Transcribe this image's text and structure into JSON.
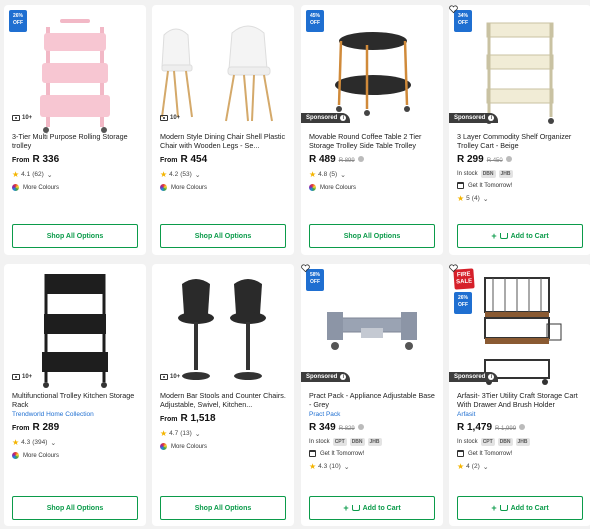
{
  "accent_color": "#0b9b4a",
  "badge_color": "#1f6fd1",
  "products": [
    {
      "discount": "26% OFF",
      "image_count": "10+",
      "title": "3-Tier Multi Purpose Rolling Storage trolley",
      "price_prefix": "From",
      "price": "R 336",
      "rating": "4.1",
      "reviews": "(62)",
      "colours_label": "More Colours",
      "button": "Shop All Options"
    },
    {
      "image_count": "10+",
      "title": "Modern Style Dining Chair Shell Plastic Chair with Wooden Legs - Se...",
      "price_prefix": "From",
      "price": "R 454",
      "rating": "4.2",
      "reviews": "(53)",
      "colours_label": "More Colours",
      "button": "Shop All Options"
    },
    {
      "discount": "45% OFF",
      "sponsored": "Sponsored",
      "title": "Movable Round Coffee Table 2 Tier Storage Trolley Side Table Trolley",
      "price": "R 489",
      "was_price": "R 899",
      "rating": "4.8",
      "reviews": "(5)",
      "colours_label": "More Colours",
      "button": "Shop All Options"
    },
    {
      "discount": "34% OFF",
      "sponsored": "Sponsored",
      "title": "3 Layer Commodity Shelf Organizer Trolley Cart - Beige",
      "price": "R 299",
      "was_price": "R 450",
      "stock": "In stock",
      "warehouses": [
        "DBN",
        "JHB"
      ],
      "delivery": "Get It Tomorrow!",
      "rating": "5",
      "reviews": "(4)",
      "button": "Add to Cart"
    },
    {
      "image_count": "10+",
      "title": "Multifunctional Trolley Kitchen Storage Rack",
      "brand": "Trendworld Home Collection",
      "price_prefix": "From",
      "price": "R 289",
      "rating": "4.3",
      "reviews": "(394)",
      "colours_label": "More Colours",
      "button": "Shop All Options"
    },
    {
      "image_count": "10+",
      "title": "Modern Bar Stools and Counter Chairs. Adjustable, Swivel, Kitchen...",
      "price_prefix": "From",
      "price": "R 1,518",
      "rating": "4.7",
      "reviews": "(13)",
      "colours_label": "More Colours",
      "button": "Shop All Options"
    },
    {
      "discount": "58% OFF",
      "sponsored": "Sponsored",
      "title": "Pract Pack - Appliance Adjustable Base - Grey",
      "brand": "Pract Pack",
      "price": "R 349",
      "was_price": "R 829",
      "stock": "In stock",
      "warehouses": [
        "CPT",
        "DBN",
        "JHB"
      ],
      "delivery": "Get It Tomorrow!",
      "rating": "4.3",
      "reviews": "(10)",
      "button": "Add to Cart"
    },
    {
      "fire_sale": "FIRE SALE",
      "discount": "26% OFF",
      "sponsored": "Sponsored",
      "title": "Arfasit- 3Tier Utility Craft Storage Cart With Drawer And Brush Holder",
      "brand": "Arfasit",
      "price": "R 1,479",
      "was_price": "R 1,999",
      "stock": "In stock",
      "warehouses": [
        "CPT",
        "DBN",
        "JHB"
      ],
      "delivery": "Get It Tomorrow!",
      "rating": "4",
      "reviews": "(2)",
      "button": "Add to Cart"
    }
  ]
}
